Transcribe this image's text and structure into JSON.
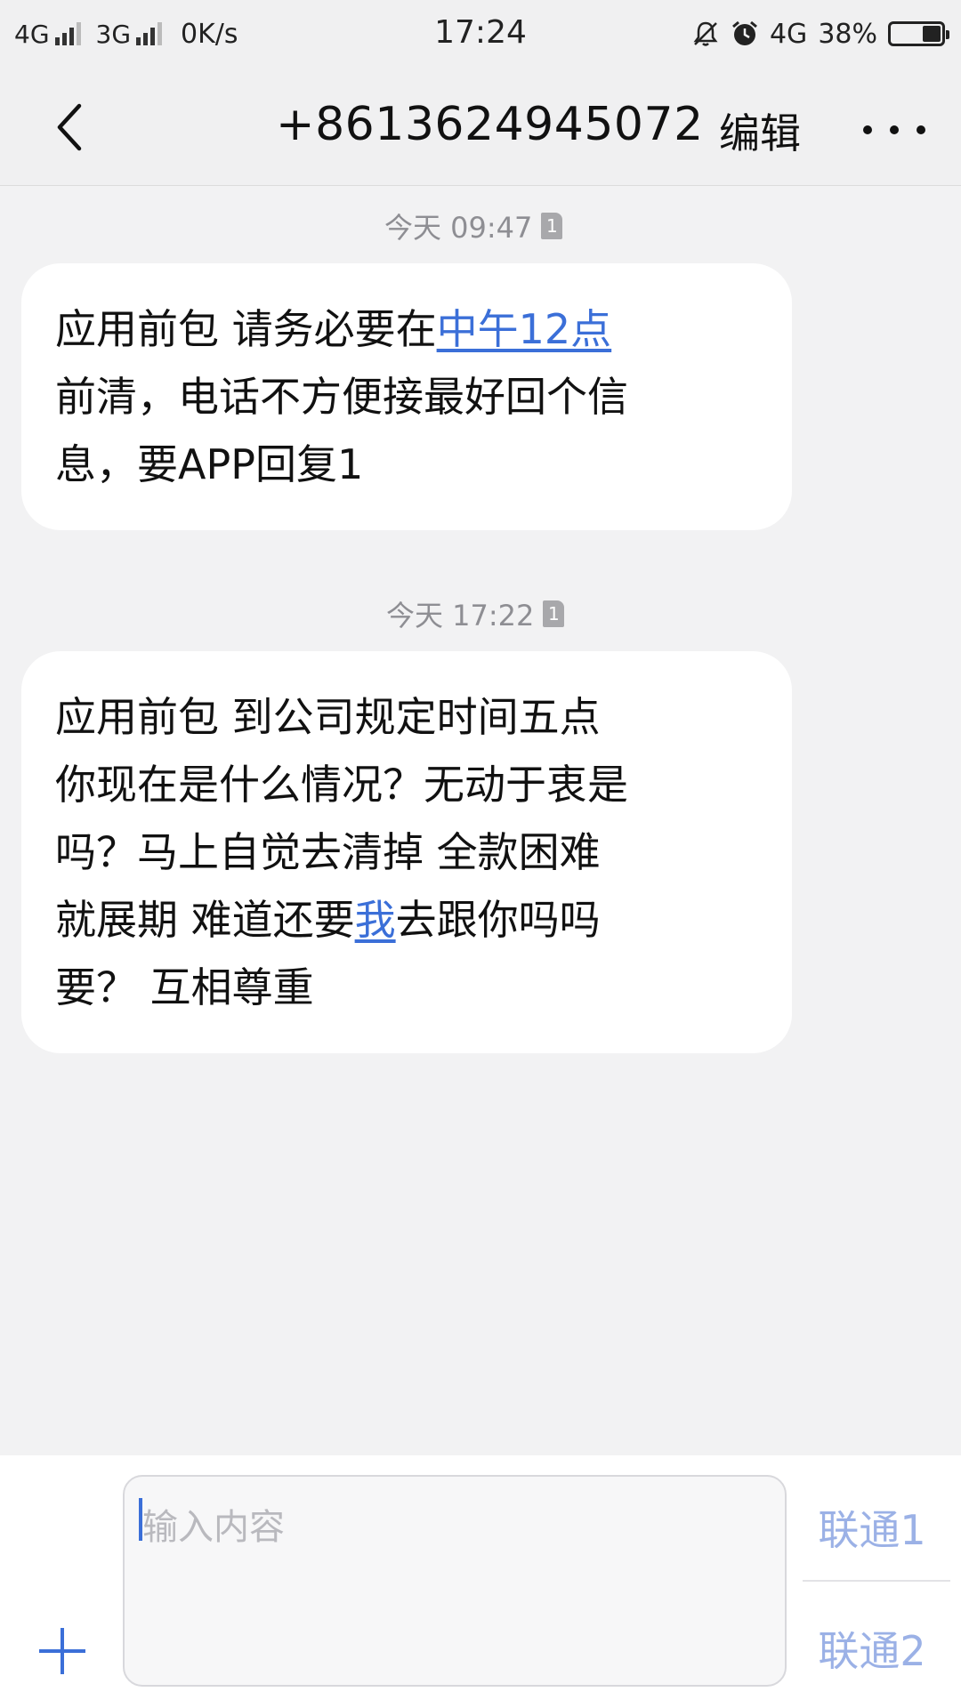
{
  "status_bar": {
    "sim1_network": "4G",
    "sim2_network": "3G",
    "speed": "0K/s",
    "time": "17:24",
    "data_network": "4G",
    "battery_percent": "38%",
    "battery_level": 0.38,
    "icons": [
      "signal-icon",
      "signal-icon",
      "mute-icon",
      "alarm-icon",
      "battery-icon"
    ]
  },
  "header": {
    "title": "+8613624945072",
    "edit_label": "编辑",
    "icons": [
      "back-arrow-icon",
      "more-icon"
    ]
  },
  "messages": [
    {
      "timestamp": "今天 09:47",
      "sim": "1",
      "lines": [
        {
          "pre": "应用前包 请务必要在",
          "link": "中午12点",
          "post": ""
        },
        {
          "pre": "前清，电话不方便接最好回个信",
          "link": "",
          "post": ""
        },
        {
          "pre": "息，要APP回复1",
          "link": "",
          "post": ""
        }
      ]
    },
    {
      "timestamp": "今天 17:22",
      "sim": "1",
      "lines": [
        {
          "pre": "应用前包 到公司规定时间五点",
          "link": "",
          "post": ""
        },
        {
          "pre": "你现在是什么情况？无动于衷是",
          "link": "",
          "post": ""
        },
        {
          "pre": "吗？马上自觉去清掉 全款困难",
          "link": "",
          "post": ""
        },
        {
          "pre": "就展期 难道还要",
          "link": "我",
          "post": "去跟你吗吗"
        },
        {
          "pre": "要？ 互相尊重",
          "link": "",
          "post": ""
        }
      ]
    }
  ],
  "composer": {
    "placeholder": "输入内容",
    "send_sim1": "联通1",
    "send_sim2": "联通2",
    "icons": [
      "add-icon"
    ]
  },
  "colors": {
    "accent": "#3b6fd8",
    "send_label": "#9bb1e6",
    "background": "#f2f2f3",
    "bubble": "#ffffff"
  }
}
